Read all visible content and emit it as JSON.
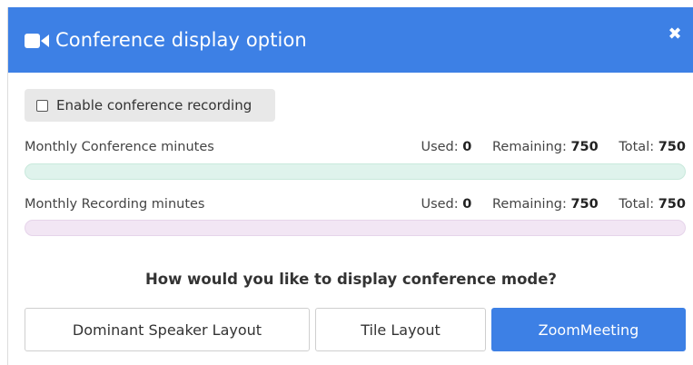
{
  "dialog": {
    "title": "Conference display option",
    "title_icon": "video-camera-icon",
    "close_symbol": "✖",
    "header_color": "#3d80e5"
  },
  "recording_toggle": {
    "label": "Enable conference recording",
    "checked": false
  },
  "usage": {
    "conference": {
      "name": "Monthly Conference minutes",
      "used_label": "Used:",
      "used": "0",
      "remaining_label": "Remaining:",
      "remaining": "750",
      "total_label": "Total:",
      "total": "750",
      "used_fraction": 0,
      "color": "#dff3ec"
    },
    "recording": {
      "name": "Monthly Recording minutes",
      "used_label": "Used:",
      "used": "0",
      "remaining_label": "Remaining:",
      "remaining": "750",
      "total_label": "Total:",
      "total": "750",
      "used_fraction": 0,
      "color": "#f2e6f4"
    }
  },
  "question": "How would you like to display conference mode?",
  "options": [
    {
      "label": "Dominant Speaker Layout",
      "selected": false
    },
    {
      "label": "Tile Layout",
      "selected": false
    },
    {
      "label": "ZoomMeeting",
      "selected": true
    }
  ]
}
